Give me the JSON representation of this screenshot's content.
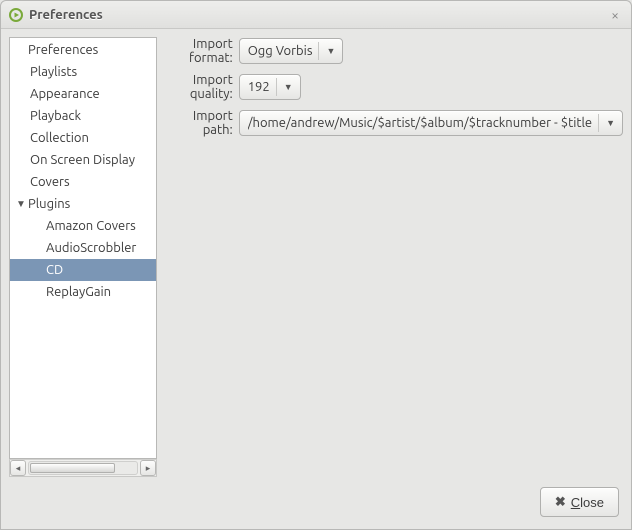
{
  "window": {
    "title": "Preferences"
  },
  "sidebar": {
    "items": [
      {
        "label": "Preferences",
        "indent": 0,
        "expander": "",
        "selected": false
      },
      {
        "label": "Playlists",
        "indent": 1,
        "expander": "",
        "selected": false
      },
      {
        "label": "Appearance",
        "indent": 1,
        "expander": "",
        "selected": false
      },
      {
        "label": "Playback",
        "indent": 1,
        "expander": "",
        "selected": false
      },
      {
        "label": "Collection",
        "indent": 1,
        "expander": "",
        "selected": false
      },
      {
        "label": "On Screen Display",
        "indent": 1,
        "expander": "",
        "selected": false
      },
      {
        "label": "Covers",
        "indent": 1,
        "expander": "",
        "selected": false
      },
      {
        "label": "Plugins",
        "indent": 0,
        "expander": "▼",
        "selected": false
      },
      {
        "label": "Amazon Covers",
        "indent": 2,
        "expander": "",
        "selected": false
      },
      {
        "label": "AudioScrobbler",
        "indent": 2,
        "expander": "",
        "selected": false
      },
      {
        "label": "CD",
        "indent": 2,
        "expander": "",
        "selected": true
      },
      {
        "label": "ReplayGain",
        "indent": 2,
        "expander": "",
        "selected": false
      }
    ]
  },
  "panel": {
    "format_label": "Import format:",
    "format_value": "Ogg Vorbis",
    "quality_label": "Import quality:",
    "quality_value": "192",
    "path_label": "Import path:",
    "path_value": "/home/andrew/Music/$artist/$album/$tracknumber - $title"
  },
  "footer": {
    "close_prefix": "C",
    "close_rest": "lose"
  }
}
